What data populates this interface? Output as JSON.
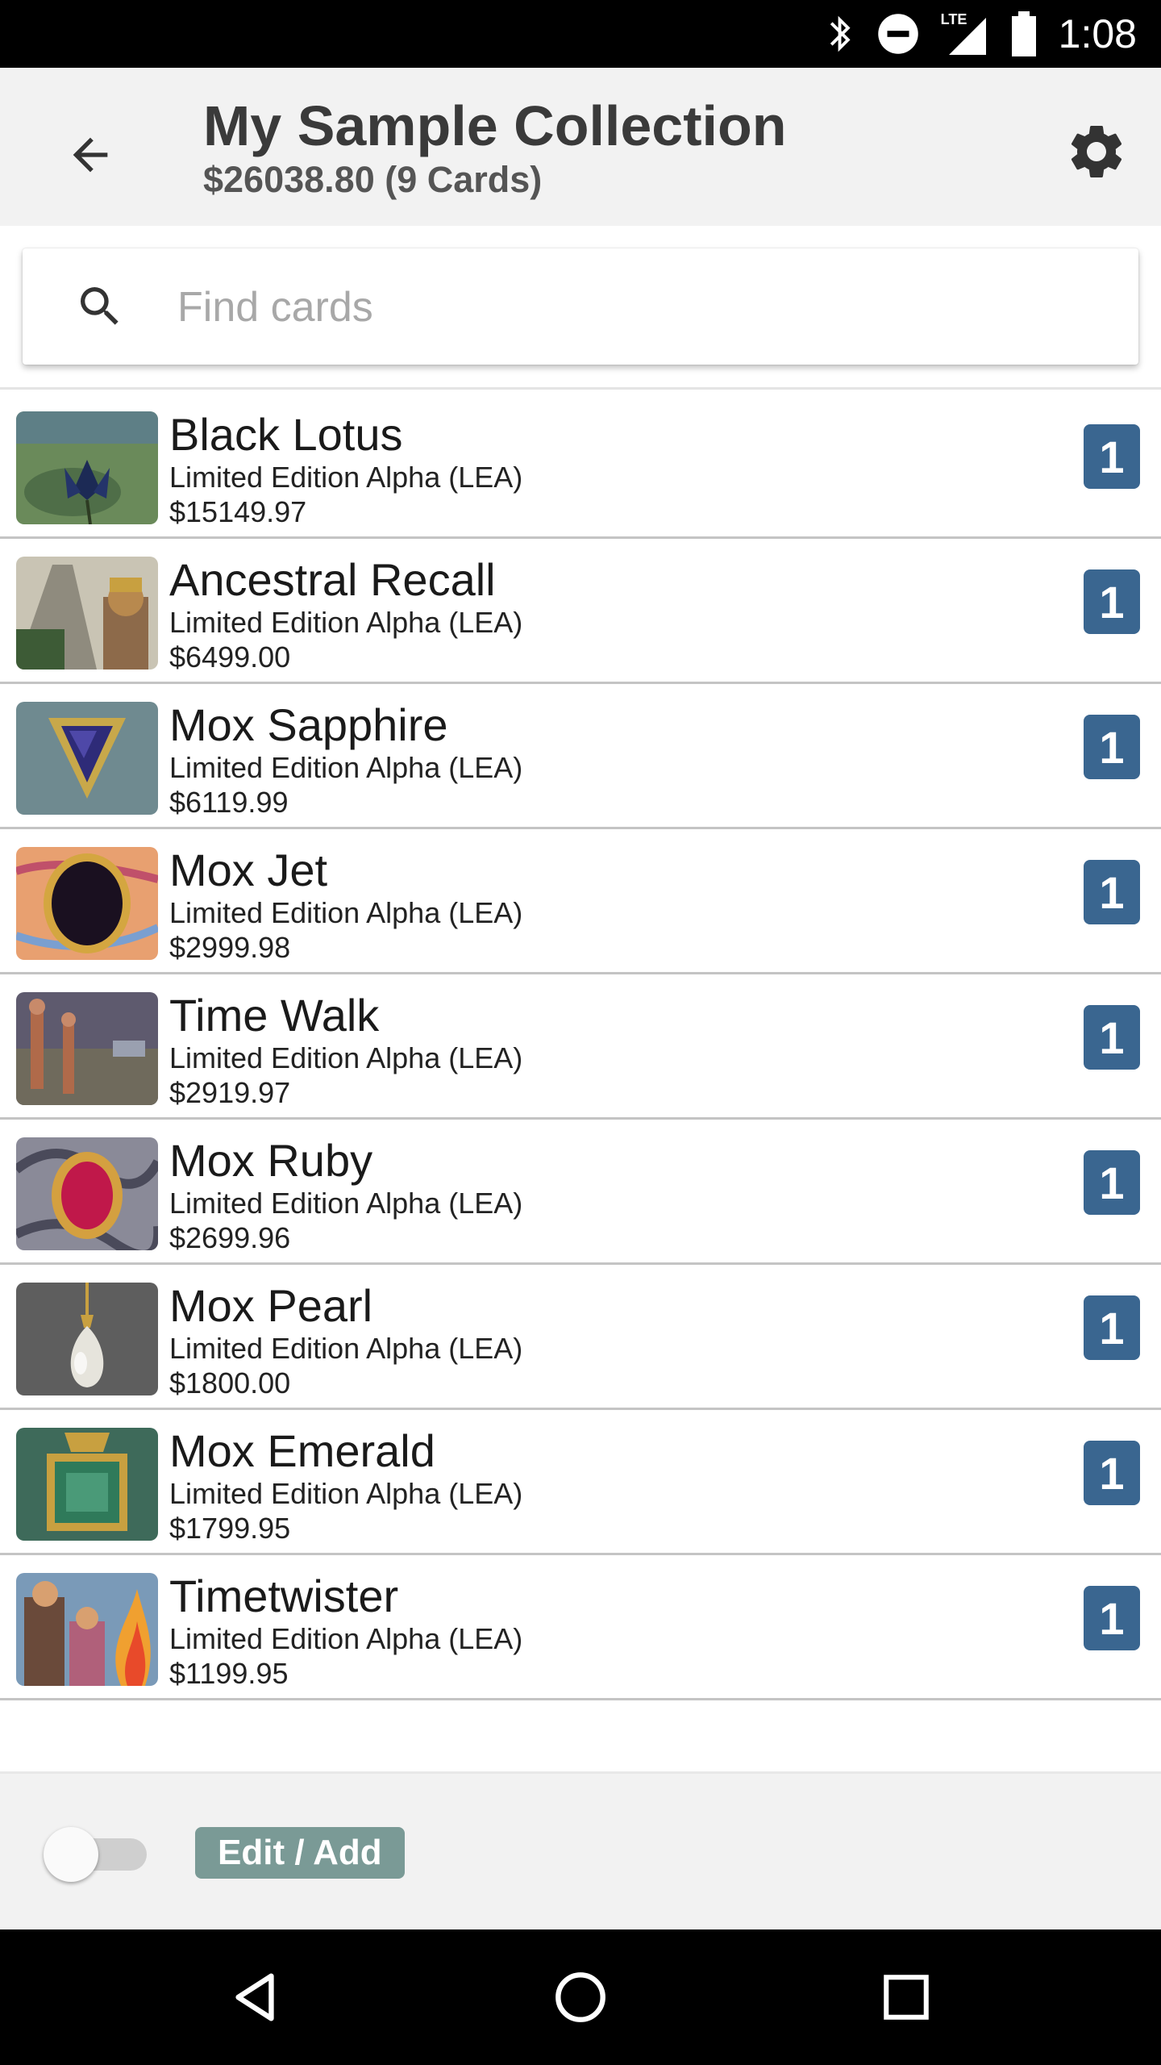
{
  "status_bar": {
    "network": "LTE",
    "time": "1:08"
  },
  "header": {
    "title": "My Sample Collection",
    "subtitle": "$26038.80 (9 Cards)"
  },
  "search": {
    "placeholder": "Find cards",
    "value": ""
  },
  "cards": [
    {
      "name": "Black Lotus",
      "set": "Limited Edition Alpha (LEA)",
      "price": "$15149.97",
      "qty": "1"
    },
    {
      "name": "Ancestral Recall",
      "set": "Limited Edition Alpha (LEA)",
      "price": "$6499.00",
      "qty": "1"
    },
    {
      "name": "Mox Sapphire",
      "set": "Limited Edition Alpha (LEA)",
      "price": "$6119.99",
      "qty": "1"
    },
    {
      "name": "Mox Jet",
      "set": "Limited Edition Alpha (LEA)",
      "price": "$2999.98",
      "qty": "1"
    },
    {
      "name": "Time Walk",
      "set": "Limited Edition Alpha (LEA)",
      "price": "$2919.97",
      "qty": "1"
    },
    {
      "name": "Mox Ruby",
      "set": "Limited Edition Alpha (LEA)",
      "price": "$2699.96",
      "qty": "1"
    },
    {
      "name": "Mox Pearl",
      "set": "Limited Edition Alpha (LEA)",
      "price": "$1800.00",
      "qty": "1"
    },
    {
      "name": "Mox Emerald",
      "set": "Limited Edition Alpha (LEA)",
      "price": "$1799.95",
      "qty": "1"
    },
    {
      "name": "Timetwister",
      "set": "Limited Edition Alpha (LEA)",
      "price": "$1199.95",
      "qty": "1"
    }
  ],
  "bottom_bar": {
    "edit_toggle_on": false,
    "edit_label": "Edit / Add"
  },
  "colors": {
    "qty_badge": "#3a6690",
    "edit_button": "#7a9a96",
    "app_bar": "#f2f2f2"
  },
  "icons": {
    "back": "arrow-left-icon",
    "settings": "gear-icon",
    "search": "search-icon",
    "nav_back": "triangle-back-icon",
    "nav_home": "circle-home-icon",
    "nav_recents": "square-recents-icon"
  }
}
